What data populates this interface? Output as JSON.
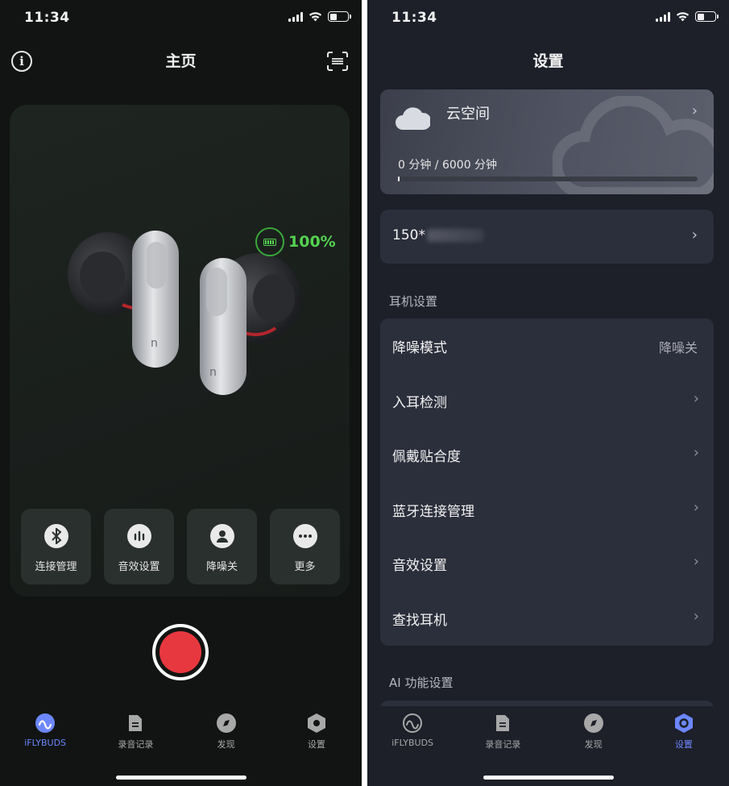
{
  "left": {
    "status": {
      "time": "11:34"
    },
    "nav": {
      "title": "主页"
    },
    "device": {
      "battery_label": "100%",
      "battery_level": 1.0
    },
    "quick_actions": [
      {
        "icon": "bluetooth-icon",
        "label": "连接管理"
      },
      {
        "icon": "equalizer-icon",
        "label": "音效设置"
      },
      {
        "icon": "person-icon",
        "label": "降噪关"
      },
      {
        "icon": "more-icon",
        "label": "更多"
      }
    ],
    "record": {
      "icon": "record-icon",
      "color": "#e8383f"
    },
    "tabs": [
      {
        "icon": "iflybuds-icon",
        "label": "iFLYBUDS",
        "active": true
      },
      {
        "icon": "document-icon",
        "label": "录音记录",
        "active": false
      },
      {
        "icon": "compass-icon",
        "label": "发现",
        "active": false
      },
      {
        "icon": "hexagon-settings-icon",
        "label": "设置",
        "active": false
      }
    ]
  },
  "right": {
    "status": {
      "time": "11:34"
    },
    "nav": {
      "title": "设置"
    },
    "cloud": {
      "title": "云空间",
      "usage": "0 分钟 / 6000 分钟",
      "usage_fraction": 0
    },
    "account": {
      "number_prefix": "150*"
    },
    "earphone_section": {
      "heading": "耳机设置",
      "rows": [
        {
          "label": "降噪模式",
          "value": "降噪关"
        },
        {
          "label": "入耳检测"
        },
        {
          "label": "佩戴贴合度"
        },
        {
          "label": "蓝牙连接管理"
        },
        {
          "label": "音效设置"
        },
        {
          "label": "查找耳机"
        }
      ]
    },
    "ai_section": {
      "heading": "AI 功能设置"
    },
    "tabs": [
      {
        "icon": "iflybuds-icon",
        "label": "iFLYBUDS",
        "active": false
      },
      {
        "icon": "document-icon",
        "label": "录音记录",
        "active": false
      },
      {
        "icon": "compass-icon",
        "label": "发现",
        "active": false
      },
      {
        "icon": "hexagon-settings-icon",
        "label": "设置",
        "active": true
      }
    ]
  },
  "colors": {
    "accent": "#6c87ff",
    "battery_green": "#53d24f",
    "record_red": "#e8383f"
  }
}
